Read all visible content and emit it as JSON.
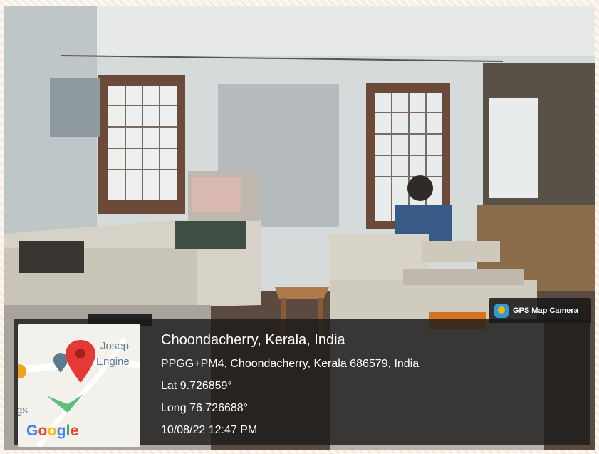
{
  "app": {
    "name": "GPS Map Camera",
    "accent_color": "#2f9ad8"
  },
  "location": {
    "place": "Choondacherry, Kerala, India",
    "address": "PPGG+PM4, Choondacherry, Kerala 686579, India",
    "latitude": "Lat 9.726859°",
    "longitude": "Long 76.726688°",
    "datetime": "10/08/22 12:47 PM"
  },
  "map": {
    "provider": "Google",
    "labels": [
      "Josep",
      "Engine",
      "gs"
    ],
    "marker_color": "#e53935",
    "pin_icon": "map-pin-icon"
  }
}
